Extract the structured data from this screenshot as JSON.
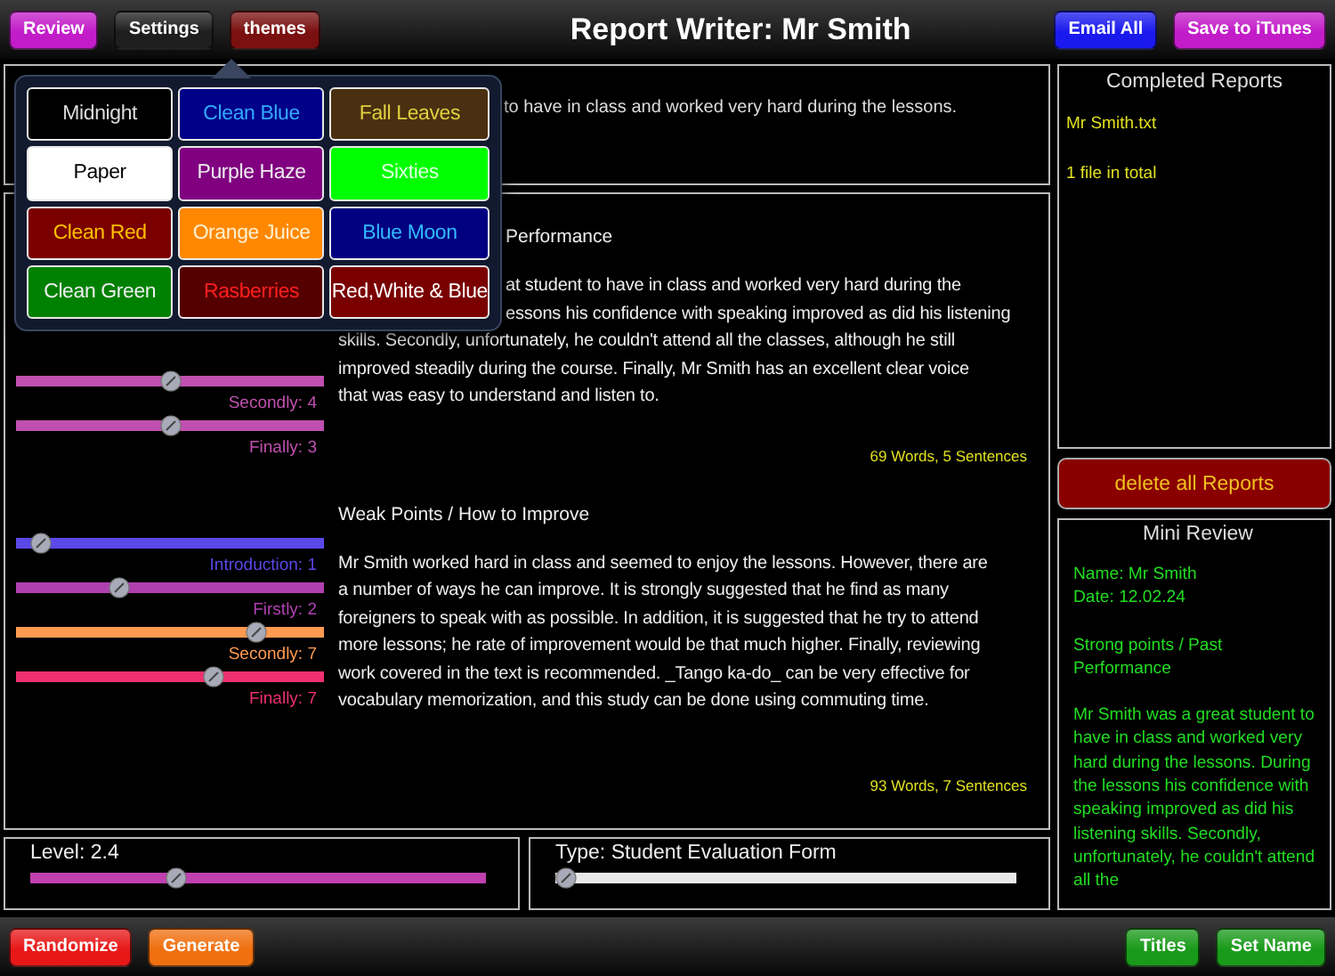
{
  "top_bar": {
    "title": "Report Writer: Mr Smith",
    "left_buttons": [
      {
        "label": "Review",
        "color": "#c21cc8"
      },
      {
        "label": "Settings",
        "color": "#1e1e1e"
      },
      {
        "label": "themes",
        "color": "#7a1010"
      }
    ],
    "right_buttons": [
      {
        "label": "Email All",
        "color": "#1a1aee"
      },
      {
        "label": "Save to iTunes",
        "color": "#c21cc8"
      }
    ]
  },
  "theme_menu": {
    "themes": [
      {
        "label": {
          "text": "Midnight",
          "color": "#dddddd"
        },
        "color": "#000000"
      },
      {
        "label": {
          "text": "Clean Blue",
          "color": "#33aaff"
        },
        "color": "#000088"
      },
      {
        "label": {
          "text": "Fall Leaves",
          "color": "#e0d040"
        },
        "color": "#4a3010"
      },
      {
        "label": {
          "text": "Paper",
          "color": "#000000"
        },
        "color": "#ffffff"
      },
      {
        "label": {
          "text": "Purple Haze",
          "color": "#eeeeee"
        },
        "color": "#800080"
      },
      {
        "label": {
          "text": "Sixties",
          "color": "#ddffdd"
        },
        "color": "#00ff00"
      },
      {
        "label": {
          "text": "Clean Red",
          "color": "#ffc000"
        },
        "color": "#7a0000"
      },
      {
        "label": {
          "text": "Orange Juice",
          "color": "#fff0d0"
        },
        "color": "#ff8800"
      },
      {
        "label": {
          "text": "Blue Moon",
          "color": "#33bbff"
        },
        "color": "#000080"
      },
      {
        "label": {
          "text": "Clean Green",
          "color": "#eeeeee"
        },
        "color": "#008000"
      },
      {
        "label": {
          "text": "Rasberries",
          "color": "#ff2020"
        },
        "color": "#550000"
      },
      {
        "label": {
          "text": "Red,White & Blue",
          "color": "#ffffff"
        },
        "color": "#7a0000"
      }
    ]
  },
  "preview": {
    "text": "to have in class and worked very hard during the lessons."
  },
  "sections": [
    {
      "heading": "Performance",
      "covered_lines": [
        "at student to have in class and worked very hard during the",
        "essons his confidence with speaking improved as did his listening"
      ],
      "lines": [
        "skills. Secondly, unfortunately, he couldn't attend all the classes, although he still",
        "improved steadily during the course. Finally, Mr Smith has an excellent clear voice",
        "that was easy to understand and listen to."
      ],
      "count": "69 Words, 5 Sentences",
      "sliders": [
        {
          "label": "Secondly: 4",
          "level": 0.5,
          "color": "#c050b0"
        },
        {
          "label": "Finally: 3",
          "level": 0.5,
          "color": "#c050b0"
        }
      ]
    },
    {
      "heading": "Weak Points / How to Improve",
      "lines": [
        "Mr Smith worked hard in class and seemed to enjoy the lessons. However, there are",
        "a number of ways he can improve. It is strongly suggested that he find as many",
        "foreigners to speak with as possible. In addition, it is suggested that he try to attend",
        "more lessons; he rate of improvement would be that much higher. Finally, reviewing",
        "work covered in the text is recommended. _Tango ka-do_ can be very effective for",
        "vocabulary memorization, and this study can be done using commuting time."
      ],
      "count": "93 Words, 7 Sentences",
      "sliders": [
        {
          "label": "Introduction: 1",
          "level": 0.05,
          "color": "#5a48e8"
        },
        {
          "label": "Firstly: 2",
          "level": 0.32,
          "color": "#b040b0"
        },
        {
          "label": "Secondly: 7",
          "level": 0.8,
          "color": "#ff9a50"
        },
        {
          "label": "Finally: 7",
          "level": 0.65,
          "color": "#ee3070"
        }
      ]
    }
  ],
  "level_panel": {
    "label": "Level: 2.4",
    "level": 0.31,
    "color": "#c040b0"
  },
  "type_panel": {
    "label": "Type: Student Evaluation Form",
    "level": 0,
    "color": "#e8e8e8"
  },
  "completed_reports": {
    "title": "Completed Reports",
    "items": [
      "Mr Smith.txt",
      "1 file in total"
    ]
  },
  "delete_button": "delete all Reports",
  "mini_review": {
    "title": "Mini Review",
    "paragraphs": [
      "Name: Mr Smith\nDate: 12.02.24",
      "Strong points / Past Performance",
      "Mr Smith was a great student to have in class and worked very hard during the lessons. During the lessons his confidence with speaking improved as did his listening skills. Secondly, unfortunately, he couldn't attend all the"
    ]
  },
  "bottom_bar": {
    "left_buttons": [
      {
        "label": "Randomize",
        "color": "#e81818"
      },
      {
        "label": "Generate",
        "color": "#f07010"
      }
    ],
    "right_buttons": [
      {
        "label": "Titles",
        "color": "#1a9a1a"
      },
      {
        "label": "Set Name",
        "color": "#1a9a1a"
      }
    ]
  }
}
